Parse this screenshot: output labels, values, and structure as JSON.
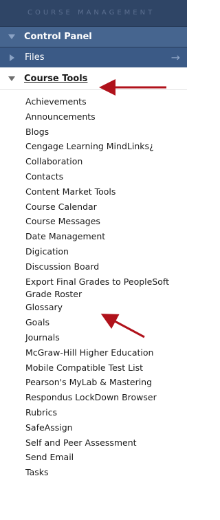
{
  "section_header": "COURSE MANAGEMENT",
  "control_panel": {
    "label": "Control Panel"
  },
  "files": {
    "label": "Files",
    "arrow": "→"
  },
  "course_tools": {
    "label": "Course Tools",
    "items": [
      "Achievements",
      "Announcements",
      "Blogs",
      "Cengage Learning MindLinks¿",
      "Collaboration",
      "Contacts",
      "Content Market Tools",
      "Course Calendar",
      "Course Messages",
      "Date Management",
      "Digication",
      "Discussion Board",
      "Export Final Grades to PeopleSoft",
      "Grade Roster",
      "Glossary",
      "Goals",
      "Journals",
      "McGraw-Hill Higher Education",
      "Mobile Compatible Test List",
      "Pearson's MyLab & Mastering",
      "Respondus LockDown Browser",
      "Rubrics",
      "SafeAssign",
      "Self and Peer Assessment",
      "Send Email",
      "Tasks"
    ]
  },
  "annotation_color": "#b0121b",
  "icons": [
    "triangle-down-icon",
    "triangle-right-icon",
    "arrow-right-icon"
  ]
}
